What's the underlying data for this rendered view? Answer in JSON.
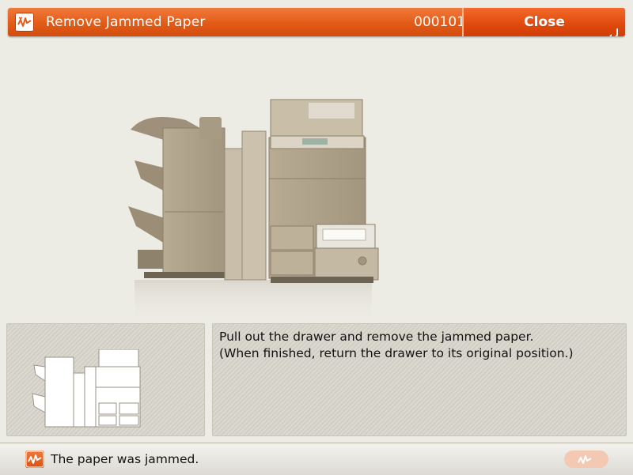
{
  "header": {
    "title": "Remove Jammed Paper",
    "code": "000101",
    "close_label": "Close",
    "icon": "paper-jam-icon",
    "accent_color": "#e35b16"
  },
  "instructions": {
    "line1": "Pull out the drawer and remove the jammed paper.",
    "line2": "(When finished, return the drawer to its original position.)"
  },
  "status": {
    "message": "The paper was jammed.",
    "icon": "paper-jam-icon"
  },
  "illustration": {
    "main": "copier-with-finisher-drawer-open",
    "thumbnail": "copier-with-finisher-overview"
  }
}
